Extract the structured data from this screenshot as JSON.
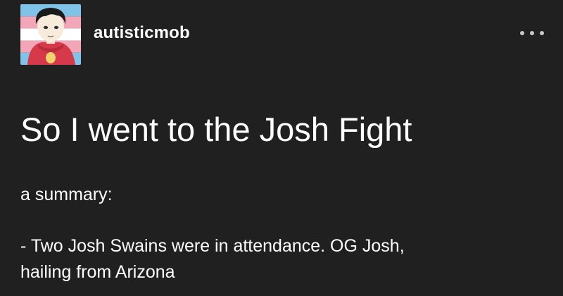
{
  "post": {
    "username": "autisticmob",
    "avatar_icon": "avatar-icon",
    "more_icon": "more-options-icon",
    "title": "So I went to the Josh Fight",
    "summary_label": "a summary:",
    "body_lines": [
      "- Two Josh Swains were in attendance. OG Josh,",
      "hailing from Arizona"
    ]
  },
  "colors": {
    "background": "#202020",
    "text": "#ffffff",
    "more_dots": "#c9c9c9",
    "avatar_stripe_blue": "#7fc4e8",
    "avatar_stripe_pink": "#f2a6b8",
    "avatar_stripe_white": "#ffffff",
    "avatar_hoodie": "#d63a4a"
  }
}
